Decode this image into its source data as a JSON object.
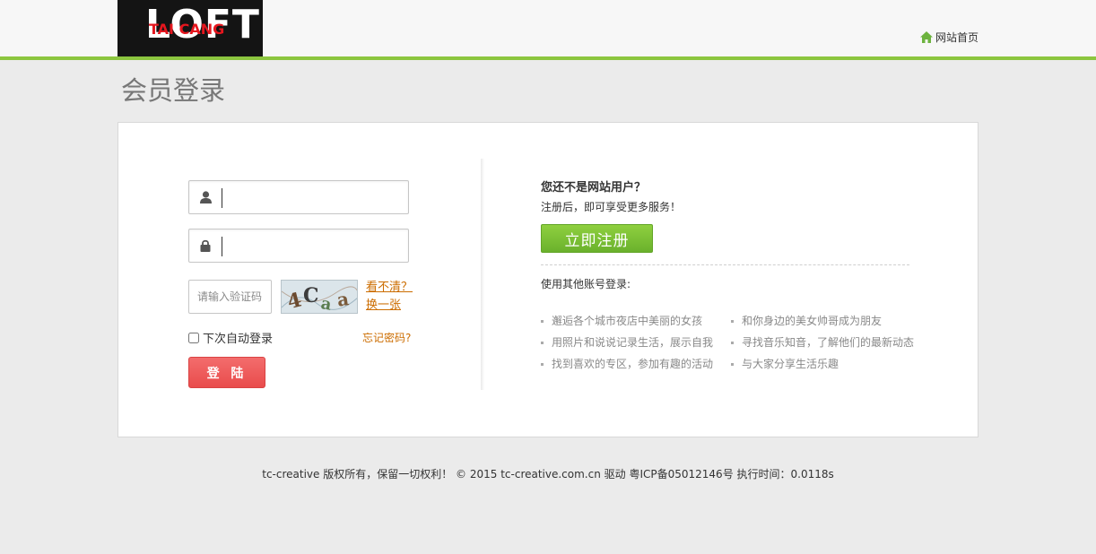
{
  "header": {
    "logo_text": "LOFT",
    "logo_sub": "TAI CANG",
    "home_link": "网站首页"
  },
  "page": {
    "title": "会员登录"
  },
  "login": {
    "username_value": "",
    "password_value": "",
    "captcha_placeholder": "请输入验证码",
    "captcha_text": "4C a a",
    "captcha_refresh_1": "看不清？",
    "captcha_refresh_2": "换一张",
    "remember_label": "下次自动登录",
    "forgot_label": "忘记密码?",
    "submit_label": "登 陆"
  },
  "register": {
    "question": "您还不是网站用户？",
    "subtitle": "注册后，即可享受更多服务！",
    "button_label": "立即注册",
    "other_login_label": "使用其他账号登录:",
    "features": [
      "邂逅各个城市夜店中美丽的女孩",
      "和你身边的美女帅哥成为朋友",
      "用照片和说说记录生活，展示自我",
      "寻找音乐知音，了解他们的最新动态",
      "找到喜欢的专区，参加有趣的活动",
      "与大家分享生活乐趣"
    ]
  },
  "footer": {
    "text": "tc-creative 版权所有，保留一切权利！ © 2015 tc-creative.com.cn 驱动 粤ICP备05012146号 执行时间：0.0118s"
  },
  "colors": {
    "accent_green": "#8cc63f",
    "register_green": "#6ab12c",
    "login_red": "#e94c4c",
    "link_orange": "#cc6d00"
  }
}
